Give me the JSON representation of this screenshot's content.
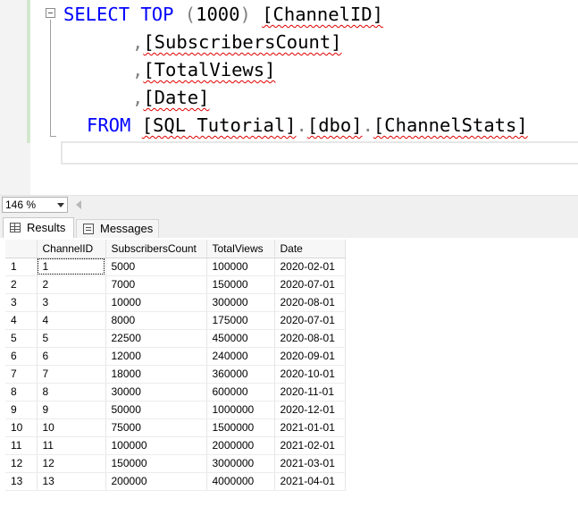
{
  "editor": {
    "lines": [
      {
        "kw1": "SELECT",
        "kw2": "TOP",
        "paren_open": "(",
        "num": "1000",
        "paren_close": ")",
        "col": "[ChannelID]"
      },
      {
        "comma": ",",
        "col": "[SubscribersCount]"
      },
      {
        "comma": ",",
        "col": "[TotalViews]"
      },
      {
        "comma": ",",
        "col": "[Date]"
      },
      {
        "kw": "FROM",
        "db": "[SQL Tutorial]",
        "dot1": ".",
        "schema": "[dbo]",
        "dot2": ".",
        "table": "[ChannelStats]"
      }
    ]
  },
  "zoom": {
    "value": "146 %"
  },
  "results": {
    "tabs": [
      {
        "label": "Results",
        "icon": "grid-icon",
        "active": true
      },
      {
        "label": "Messages",
        "icon": "messages-icon",
        "active": false
      }
    ],
    "columns": [
      "",
      "ChannelID",
      "SubscribersCount",
      "TotalViews",
      "Date"
    ],
    "rows": [
      [
        "1",
        "1",
        "5000",
        "100000",
        "2020-02-01"
      ],
      [
        "2",
        "2",
        "7000",
        "150000",
        "2020-07-01"
      ],
      [
        "3",
        "3",
        "10000",
        "300000",
        "2020-08-01"
      ],
      [
        "4",
        "4",
        "8000",
        "175000",
        "2020-07-01"
      ],
      [
        "5",
        "5",
        "22500",
        "450000",
        "2020-08-01"
      ],
      [
        "6",
        "6",
        "12000",
        "240000",
        "2020-09-01"
      ],
      [
        "7",
        "7",
        "18000",
        "360000",
        "2020-10-01"
      ],
      [
        "8",
        "8",
        "30000",
        "600000",
        "2020-11-01"
      ],
      [
        "9",
        "9",
        "50000",
        "1000000",
        "2020-12-01"
      ],
      [
        "10",
        "10",
        "75000",
        "1500000",
        "2021-01-01"
      ],
      [
        "11",
        "11",
        "100000",
        "2000000",
        "2021-02-01"
      ],
      [
        "12",
        "12",
        "150000",
        "3000000",
        "2021-03-01"
      ],
      [
        "13",
        "13",
        "200000",
        "4000000",
        "2021-04-01"
      ]
    ]
  },
  "colors": {
    "keyword": "#0000ff",
    "operator": "#808080",
    "squiggle": "#e00000",
    "change_bar": "#d3e7cf"
  }
}
